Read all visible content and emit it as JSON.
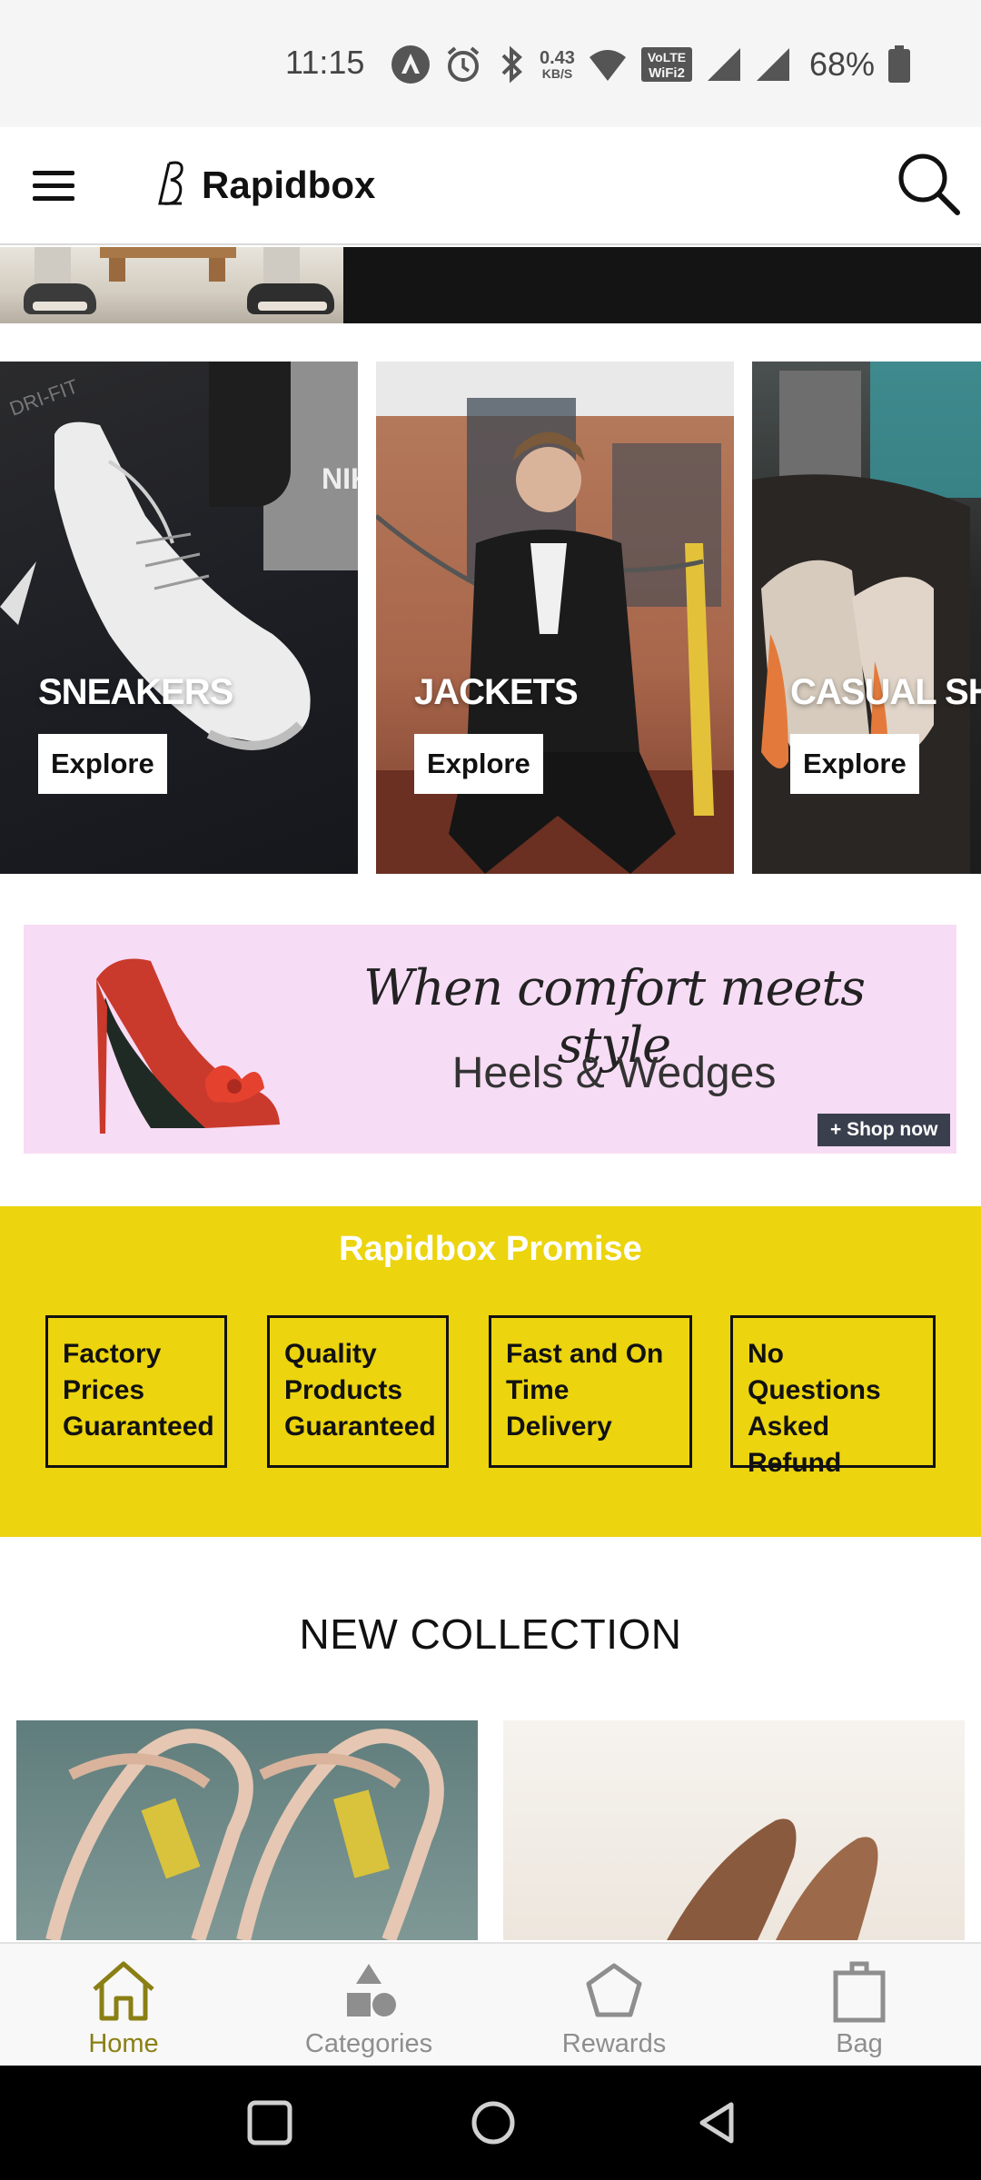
{
  "status_bar": {
    "time": "11:15",
    "data_speed_value": "0.43",
    "data_speed_unit": "KB/S",
    "volte_label": "VoLTE",
    "wifi2_label": "WiFi2",
    "battery_percent": "68%",
    "icons": [
      "nav-app-icon",
      "alarm-icon",
      "bluetooth-icon",
      "wifi-icon",
      "volte-icon",
      "signal-icon",
      "signal-icon",
      "battery-icon"
    ]
  },
  "header": {
    "brand_name": "Rapidbox",
    "icons": [
      "hamburger-menu-icon",
      "brand-logo-icon",
      "search-icon"
    ]
  },
  "categories": [
    {
      "title": "SNEAKERS",
      "button_label": "Explore"
    },
    {
      "title": "JACKETS",
      "button_label": "Explore"
    },
    {
      "title": "CASUAL SHOES",
      "button_label": "Explore"
    }
  ],
  "promo_banner": {
    "tagline": "When comfort meets style",
    "subtitle": "Heels & Wedges",
    "cta_label": "+ Shop now"
  },
  "promise": {
    "title": "Rapidbox Promise",
    "items": [
      {
        "label": "Factory Prices Guaranteed"
      },
      {
        "label": "Quality Products Guaranteed"
      },
      {
        "label": "Fast and On Time Delivery"
      },
      {
        "label": "No Questions Asked Refund"
      }
    ]
  },
  "new_collection": {
    "title": "NEW COLLECTION"
  },
  "bottom_nav": {
    "items": [
      {
        "label": "Home",
        "icon": "home-icon",
        "active": true
      },
      {
        "label": "Categories",
        "icon": "categories-icon",
        "active": false
      },
      {
        "label": "Rewards",
        "icon": "rewards-icon",
        "active": false
      },
      {
        "label": "Bag",
        "icon": "bag-icon",
        "active": false
      }
    ]
  },
  "colors": {
    "promise_background": "#ecd40e",
    "promo_background": "#f7dcf5",
    "active_nav": "#8a7f14",
    "inactive_nav": "#8e8e8e",
    "shop_now_button": "#3a3f4e"
  }
}
